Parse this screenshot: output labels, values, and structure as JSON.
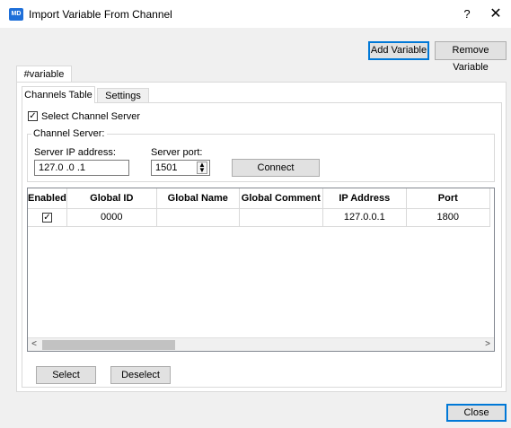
{
  "window": {
    "title": "Import Variable From Channel",
    "app_icon_text": "MD",
    "help_label": "?",
    "close_label": "✕"
  },
  "toolbar": {
    "add_variable": "Add Variable",
    "remove_variable": "Remove Variable"
  },
  "outer_tab": {
    "label": "#variable"
  },
  "inner_tabs": {
    "channels_table": "Channels Table",
    "settings": "Settings"
  },
  "select_server": {
    "label": "Select Channel Server",
    "checked": true
  },
  "server_group": {
    "legend": "Channel Server:",
    "ip_label": "Server IP address:",
    "ip_value": "127.0 .0 .1",
    "port_label": "Server port:",
    "port_value": "1501",
    "connect_label": "Connect"
  },
  "table": {
    "columns": [
      "Enabled",
      "Global ID",
      "Global Name",
      "Global Comment",
      "IP Address",
      "Port"
    ],
    "rows": [
      {
        "enabled": true,
        "global_id": "0000",
        "global_name": "",
        "global_comment": "",
        "ip_address": "127.0.0.1",
        "port": "1800"
      }
    ]
  },
  "bottom": {
    "select_label": "Select",
    "deselect_label": "Deselect",
    "close_label": "Close"
  },
  "colors": {
    "accent": "#0078d7",
    "app_icon": "#1e6fd9"
  }
}
